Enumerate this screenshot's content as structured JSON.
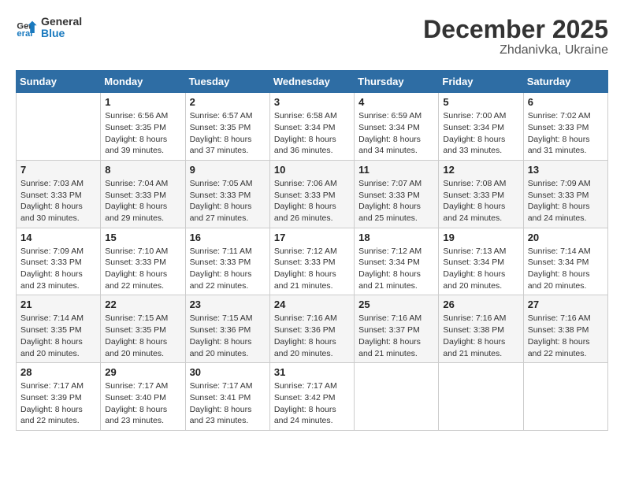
{
  "header": {
    "logo_general": "General",
    "logo_blue": "Blue",
    "title": "December 2025",
    "subtitle": "Zhdanivka, Ukraine"
  },
  "days_of_week": [
    "Sunday",
    "Monday",
    "Tuesday",
    "Wednesday",
    "Thursday",
    "Friday",
    "Saturday"
  ],
  "weeks": [
    [
      {
        "day": "",
        "info": ""
      },
      {
        "day": "1",
        "info": "Sunrise: 6:56 AM\nSunset: 3:35 PM\nDaylight: 8 hours\nand 39 minutes."
      },
      {
        "day": "2",
        "info": "Sunrise: 6:57 AM\nSunset: 3:35 PM\nDaylight: 8 hours\nand 37 minutes."
      },
      {
        "day": "3",
        "info": "Sunrise: 6:58 AM\nSunset: 3:34 PM\nDaylight: 8 hours\nand 36 minutes."
      },
      {
        "day": "4",
        "info": "Sunrise: 6:59 AM\nSunset: 3:34 PM\nDaylight: 8 hours\nand 34 minutes."
      },
      {
        "day": "5",
        "info": "Sunrise: 7:00 AM\nSunset: 3:34 PM\nDaylight: 8 hours\nand 33 minutes."
      },
      {
        "day": "6",
        "info": "Sunrise: 7:02 AM\nSunset: 3:33 PM\nDaylight: 8 hours\nand 31 minutes."
      }
    ],
    [
      {
        "day": "7",
        "info": "Sunrise: 7:03 AM\nSunset: 3:33 PM\nDaylight: 8 hours\nand 30 minutes."
      },
      {
        "day": "8",
        "info": "Sunrise: 7:04 AM\nSunset: 3:33 PM\nDaylight: 8 hours\nand 29 minutes."
      },
      {
        "day": "9",
        "info": "Sunrise: 7:05 AM\nSunset: 3:33 PM\nDaylight: 8 hours\nand 27 minutes."
      },
      {
        "day": "10",
        "info": "Sunrise: 7:06 AM\nSunset: 3:33 PM\nDaylight: 8 hours\nand 26 minutes."
      },
      {
        "day": "11",
        "info": "Sunrise: 7:07 AM\nSunset: 3:33 PM\nDaylight: 8 hours\nand 25 minutes."
      },
      {
        "day": "12",
        "info": "Sunrise: 7:08 AM\nSunset: 3:33 PM\nDaylight: 8 hours\nand 24 minutes."
      },
      {
        "day": "13",
        "info": "Sunrise: 7:09 AM\nSunset: 3:33 PM\nDaylight: 8 hours\nand 24 minutes."
      }
    ],
    [
      {
        "day": "14",
        "info": "Sunrise: 7:09 AM\nSunset: 3:33 PM\nDaylight: 8 hours\nand 23 minutes."
      },
      {
        "day": "15",
        "info": "Sunrise: 7:10 AM\nSunset: 3:33 PM\nDaylight: 8 hours\nand 22 minutes."
      },
      {
        "day": "16",
        "info": "Sunrise: 7:11 AM\nSunset: 3:33 PM\nDaylight: 8 hours\nand 22 minutes."
      },
      {
        "day": "17",
        "info": "Sunrise: 7:12 AM\nSunset: 3:33 PM\nDaylight: 8 hours\nand 21 minutes."
      },
      {
        "day": "18",
        "info": "Sunrise: 7:12 AM\nSunset: 3:34 PM\nDaylight: 8 hours\nand 21 minutes."
      },
      {
        "day": "19",
        "info": "Sunrise: 7:13 AM\nSunset: 3:34 PM\nDaylight: 8 hours\nand 20 minutes."
      },
      {
        "day": "20",
        "info": "Sunrise: 7:14 AM\nSunset: 3:34 PM\nDaylight: 8 hours\nand 20 minutes."
      }
    ],
    [
      {
        "day": "21",
        "info": "Sunrise: 7:14 AM\nSunset: 3:35 PM\nDaylight: 8 hours\nand 20 minutes."
      },
      {
        "day": "22",
        "info": "Sunrise: 7:15 AM\nSunset: 3:35 PM\nDaylight: 8 hours\nand 20 minutes."
      },
      {
        "day": "23",
        "info": "Sunrise: 7:15 AM\nSunset: 3:36 PM\nDaylight: 8 hours\nand 20 minutes."
      },
      {
        "day": "24",
        "info": "Sunrise: 7:16 AM\nSunset: 3:36 PM\nDaylight: 8 hours\nand 20 minutes."
      },
      {
        "day": "25",
        "info": "Sunrise: 7:16 AM\nSunset: 3:37 PM\nDaylight: 8 hours\nand 21 minutes."
      },
      {
        "day": "26",
        "info": "Sunrise: 7:16 AM\nSunset: 3:38 PM\nDaylight: 8 hours\nand 21 minutes."
      },
      {
        "day": "27",
        "info": "Sunrise: 7:16 AM\nSunset: 3:38 PM\nDaylight: 8 hours\nand 22 minutes."
      }
    ],
    [
      {
        "day": "28",
        "info": "Sunrise: 7:17 AM\nSunset: 3:39 PM\nDaylight: 8 hours\nand 22 minutes."
      },
      {
        "day": "29",
        "info": "Sunrise: 7:17 AM\nSunset: 3:40 PM\nDaylight: 8 hours\nand 23 minutes."
      },
      {
        "day": "30",
        "info": "Sunrise: 7:17 AM\nSunset: 3:41 PM\nDaylight: 8 hours\nand 23 minutes."
      },
      {
        "day": "31",
        "info": "Sunrise: 7:17 AM\nSunset: 3:42 PM\nDaylight: 8 hours\nand 24 minutes."
      },
      {
        "day": "",
        "info": ""
      },
      {
        "day": "",
        "info": ""
      },
      {
        "day": "",
        "info": ""
      }
    ]
  ]
}
